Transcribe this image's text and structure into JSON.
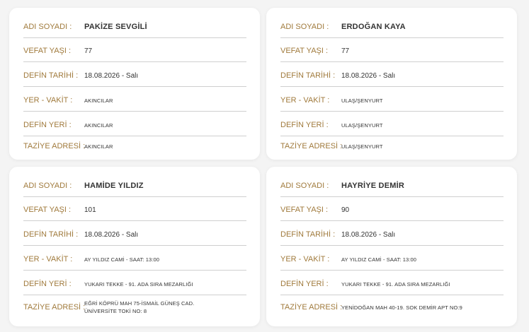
{
  "labels": {
    "name": "ADI SOYADI :",
    "age": "VEFAT YAŞI :",
    "burial_date": "DEFİN TARİHİ :",
    "place_time": "YER - VAKİT :",
    "burial_place": "DEFİN YERİ :",
    "condolence_address": "TAZİYE ADRESİ :"
  },
  "cards": [
    {
      "name": "PAKİZE SEVGİLİ",
      "age": "77",
      "burial_date": "18.08.2026 - Salı",
      "place_time": "AKINCILAR",
      "burial_place": "AKINCILAR",
      "condolence_address": "AKINCILAR"
    },
    {
      "name": "ERDOĞAN KAYA",
      "age": "77",
      "burial_date": "18.08.2026 - Salı",
      "place_time": "ULAŞ/ŞENYURT",
      "burial_place": "ULAŞ/ŞENYURT",
      "condolence_address": "ULAŞ/ŞENYURT"
    },
    {
      "name": "HAMİDE YILDIZ",
      "age": "101",
      "burial_date": "18.08.2026 - Salı",
      "place_time": "AY YILDIZ CAMİ - SAAT: 13:00",
      "burial_place": "YUKARI TEKKE - 91. ADA SIRA MEZARLIĞI",
      "condolence_address": "EĞRİ KÖPRÜ MAH 75-İSMAİL GÜNEŞ CAD. ÜNİVERSİTE TOKİ NO: 8"
    },
    {
      "name": "HAYRİYE DEMİR",
      "age": "90",
      "burial_date": "18.08.2026 - Salı",
      "place_time": "AY YILDIZ CAMİ - SAAT: 13:00",
      "burial_place": "YUKARI TEKKE - 91. ADA SIRA MEZARLIĞI",
      "condolence_address": "YENİDOĞAN MAH 40-19. SOK DEMİR APT NO:9"
    }
  ],
  "colors": {
    "label": "#a07a3c",
    "value": "#333333",
    "divider": "#cfcfcf",
    "card_bg": "#ffffff",
    "page_bg": "#f4f4f4"
  }
}
